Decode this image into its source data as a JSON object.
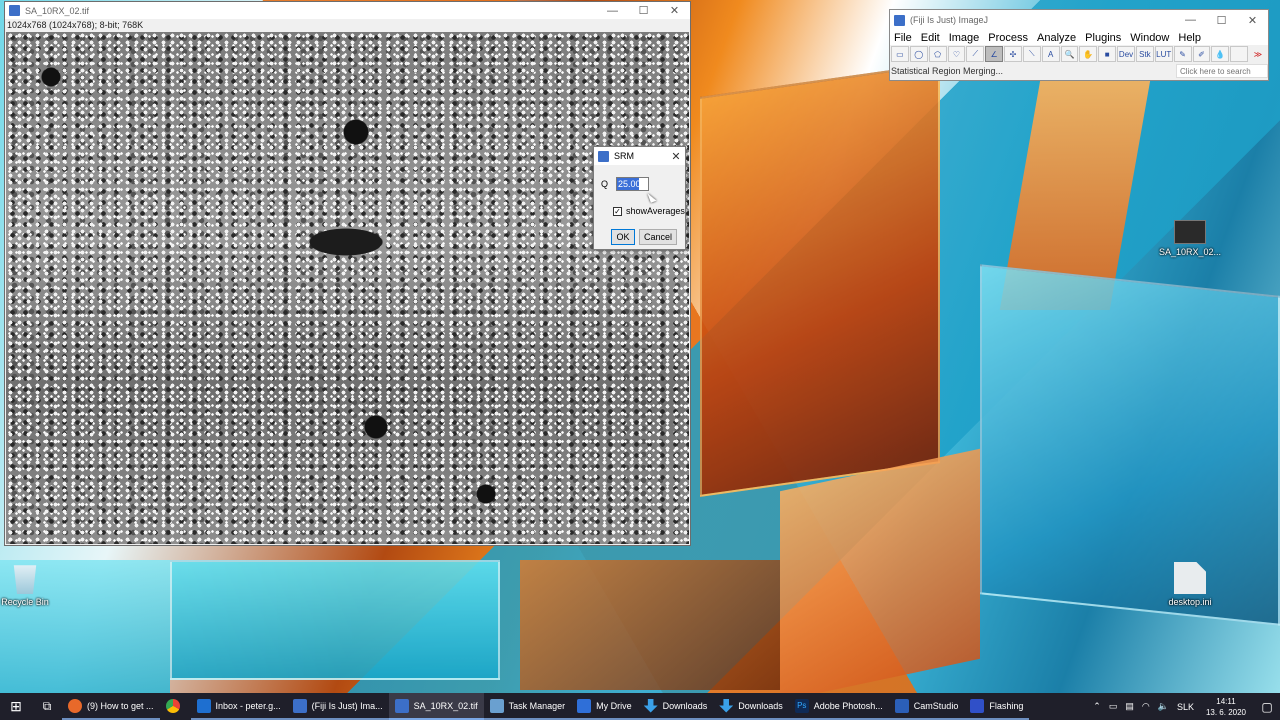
{
  "image_window": {
    "title": "SA_10RX_02.tif",
    "info": "1024x768   (1024x768); 8-bit; 768K",
    "controls": [
      "—",
      "☐",
      "✕"
    ]
  },
  "srm_dialog": {
    "title": "SRM",
    "q_label": "Q",
    "q_value": "25.00",
    "checkbox_label": "showAverages",
    "checkbox_checked": true,
    "ok_label": "OK",
    "cancel_label": "Cancel"
  },
  "imagej": {
    "title": "(Fiji Is Just) ImageJ",
    "menu": [
      "File",
      "Edit",
      "Image",
      "Process",
      "Analyze",
      "Plugins",
      "Window",
      "Help"
    ],
    "tools": [
      "▭",
      "◯",
      "⬠",
      "♡",
      "⟋",
      "∠",
      "✣",
      "⟍",
      "A",
      "🔍",
      "✋",
      "■",
      "Dev",
      "Stk",
      "LUT",
      "✎",
      "✐",
      "💧",
      "",
      "≫"
    ],
    "status": "Statistical Region Merging...",
    "search_placeholder": "Click here to search"
  },
  "desktop": {
    "recycle_bin": "Recycle Bin",
    "tif_file": "SA_10RX_02...",
    "ini_file": "desktop.ini"
  },
  "taskbar": {
    "items": [
      {
        "label": "(9) How to get ...",
        "color": "#e8692a"
      },
      {
        "label": "",
        "color": "#34a853"
      },
      {
        "label": "Inbox - peter.g...",
        "color": "#1e6fd0"
      },
      {
        "label": "(Fiji Is Just) Ima...",
        "color": "#3c6fc8"
      },
      {
        "label": "SA_10RX_02.tif",
        "color": "#3c6fc8"
      },
      {
        "label": "Task Manager",
        "color": "#6aa0d0"
      },
      {
        "label": "My Drive",
        "color": "#2f6fd8"
      },
      {
        "label": "Downloads",
        "color": "#3aa0e8"
      },
      {
        "label": "Downloads",
        "color": "#3aa0e8"
      },
      {
        "label": "Adobe Photosh...",
        "color": "#0f2a55"
      },
      {
        "label": "CamStudio",
        "color": "#2b5fb8"
      },
      {
        "label": "Flashing",
        "color": "#3050c8"
      }
    ],
    "lang": "SLK",
    "time": "14:11",
    "date": "13. 6. 2020"
  }
}
